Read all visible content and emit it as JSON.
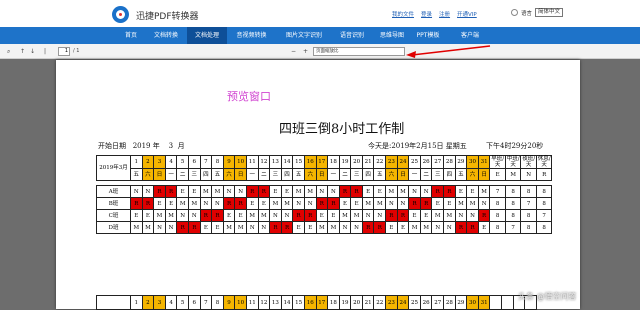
{
  "app": {
    "brand": "迅捷PDF转换器",
    "links": [
      "我的文件",
      "登录",
      "注册",
      "开通VIP"
    ],
    "lang_label": "语言",
    "lang_value": "简体中文"
  },
  "nav": [
    "首页",
    "文档转换",
    "文档处理",
    "音视频转换",
    "图片文字识别",
    "语音识别",
    "思维导图",
    "PPT模板",
    "客户端"
  ],
  "nav_active": "文档处理",
  "toolbar": {
    "page_value": "1",
    "page_count": "/ 1",
    "zoom_value": "页面缩放比",
    "zoom_minus": "−",
    "zoom_plus": "+"
  },
  "doc": {
    "preview_label": "预览窗口",
    "title": "四班三倒8小时工作制",
    "start_label": "开始日期",
    "start_year": "2019",
    "start_year_unit": "年",
    "start_month": "3",
    "start_month_unit": "月",
    "today": "今天是:2019年2月15日  星期五",
    "time": "下午4时29分20秒"
  },
  "table": {
    "month_label": "2019年3月",
    "days": [
      "1",
      "2",
      "3",
      "4",
      "5",
      "6",
      "7",
      "8",
      "9",
      "10",
      "11",
      "12",
      "13",
      "14",
      "15",
      "16",
      "17",
      "18",
      "19",
      "20",
      "21",
      "22",
      "23",
      "24",
      "25",
      "26",
      "27",
      "28",
      "29",
      "30",
      "31"
    ],
    "weekdays": [
      "五",
      "六",
      "日",
      "一",
      "二",
      "三",
      "四",
      "五",
      "六",
      "日",
      "一",
      "二",
      "三",
      "四",
      "五",
      "六",
      "日",
      "一",
      "二",
      "三",
      "四",
      "五",
      "六",
      "日",
      "一",
      "二",
      "三",
      "四",
      "五",
      "六",
      "日"
    ],
    "weekend_days": [
      2,
      3,
      9,
      10,
      16,
      17,
      23,
      24,
      30,
      31
    ],
    "summary_headers": [
      "早班/天",
      "中班/天",
      "夜班/天",
      "休息/天"
    ],
    "summary_row2": [
      "E",
      "M",
      "N",
      "R"
    ],
    "rows": [
      {
        "label": "A班",
        "cells": [
          "N",
          "N",
          "R",
          "R",
          "E",
          "E",
          "M",
          "M",
          "N",
          "N",
          "R",
          "R",
          "E",
          "E",
          "M",
          "M",
          "N",
          "N",
          "R",
          "R",
          "E",
          "E",
          "M",
          "M",
          "N",
          "N",
          "R",
          "R",
          "E",
          "E",
          "M"
        ],
        "summary": [
          "7",
          "8",
          "8",
          "8"
        ]
      },
      {
        "label": "B班",
        "cells": [
          "R",
          "R",
          "E",
          "E",
          "M",
          "M",
          "N",
          "N",
          "R",
          "R",
          "E",
          "E",
          "M",
          "M",
          "N",
          "N",
          "R",
          "R",
          "E",
          "E",
          "M",
          "M",
          "N",
          "N",
          "R",
          "R",
          "E",
          "E",
          "M",
          "M",
          "N"
        ],
        "summary": [
          "8",
          "8",
          "7",
          "8"
        ]
      },
      {
        "label": "C班",
        "cells": [
          "E",
          "E",
          "M",
          "M",
          "N",
          "N",
          "R",
          "R",
          "E",
          "E",
          "M",
          "M",
          "N",
          "N",
          "R",
          "R",
          "E",
          "E",
          "M",
          "M",
          "N",
          "N",
          "R",
          "R",
          "E",
          "E",
          "M",
          "M",
          "N",
          "N",
          "R"
        ],
        "summary": [
          "8",
          "8",
          "8",
          "7"
        ]
      },
      {
        "label": "D班",
        "cells": [
          "M",
          "M",
          "N",
          "N",
          "R",
          "R",
          "E",
          "E",
          "M",
          "M",
          "N",
          "N",
          "R",
          "R",
          "E",
          "E",
          "M",
          "M",
          "N",
          "N",
          "R",
          "R",
          "E",
          "E",
          "M",
          "M",
          "N",
          "N",
          "R",
          "R",
          "E"
        ],
        "summary": [
          "8",
          "7",
          "8",
          "8"
        ]
      }
    ],
    "second_days": [
      "1",
      "2",
      "3",
      "4",
      "5",
      "6",
      "7",
      "8",
      "9",
      "10",
      "11",
      "12",
      "13",
      "14",
      "15",
      "16",
      "17",
      "18",
      "19",
      "20",
      "21",
      "22",
      "23",
      "24",
      "25",
      "26",
      "27",
      "28",
      "29",
      "30",
      "31"
    ]
  },
  "watermark": "头条 @悟空问答",
  "colors": {
    "nav": "#1e73c9",
    "nav_active": "#0e4f98",
    "weekend": "#f5b500",
    "rest": "#e00000",
    "preview": "#d146d1"
  }
}
